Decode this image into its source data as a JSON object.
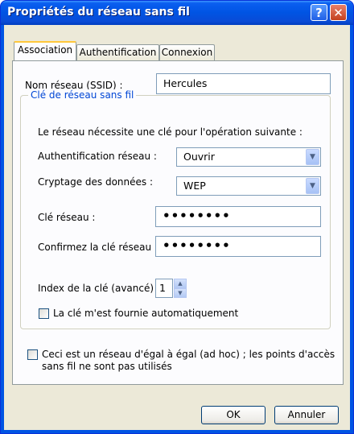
{
  "window": {
    "title": "Propriétés du réseau sans fil",
    "help_glyph": "?",
    "close_glyph": "✕"
  },
  "tabs": [
    {
      "label": "Association",
      "active": true
    },
    {
      "label": "Authentification",
      "active": false
    },
    {
      "label": "Connexion",
      "active": false
    }
  ],
  "ssid": {
    "label": "Nom réseau (SSID) :",
    "value": "Hercules"
  },
  "wireless_key": {
    "group_title": "Clé de réseau sans fil",
    "requirement_text": "Le réseau nécessite une clé pour l'opération suivante :",
    "auth": {
      "label": "Authentification réseau :",
      "value": "Ouvrir"
    },
    "encryption": {
      "label": "Cryptage des données :",
      "value": "WEP"
    },
    "key": {
      "label": "Clé réseau :",
      "value": "••••••••"
    },
    "confirm_key": {
      "label": "Confirmez la clé réseau :",
      "value": "••••••••"
    },
    "key_index": {
      "label": "Index de la clé (avancé) :",
      "value": "1"
    },
    "auto_key": {
      "label": "La clé m'est fournie automatiquement",
      "checked": false
    }
  },
  "adhoc": {
    "line1": "Ceci est un réseau d'égal à égal (ad hoc) ; les points d'accès",
    "line2": "sans fil ne sont pas utilisés",
    "checked": false
  },
  "buttons": {
    "ok": "OK",
    "cancel": "Annuler"
  },
  "icons": {
    "dropdown": "chevron-down-icon",
    "spin_up": "triangle-up-icon",
    "spin_down": "triangle-down-icon"
  },
  "colors": {
    "title_bar": "#0054e3",
    "dialog_bg": "#ece9d8",
    "panel_bg": "#fcfcfe",
    "group_title": "#0046d5",
    "active_tab_accent": "#ffc83c"
  }
}
